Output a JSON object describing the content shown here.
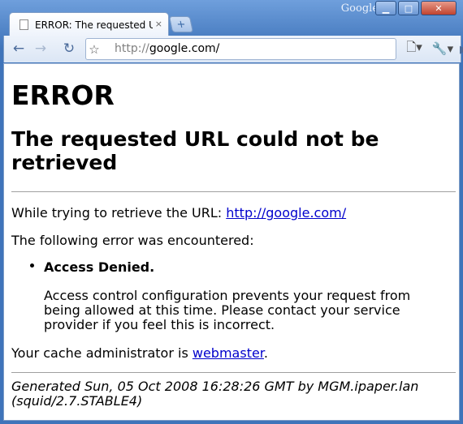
{
  "window": {
    "brand": "Google",
    "controls": {
      "minimize": "▁",
      "maximize": "□",
      "close": "✕"
    }
  },
  "tab": {
    "title": "ERROR: The requested U...",
    "close": "×",
    "new_tab": "+"
  },
  "toolbar": {
    "back": "←",
    "forward": "→",
    "reload": "↻",
    "star": "☆",
    "url_scheme": "http://",
    "url_host": "google.com/",
    "go": "▶",
    "page_menu": "🗋▾",
    "tools_menu": "🔧▾"
  },
  "page": {
    "heading": "ERROR",
    "subheading": "The requested URL could not be retrieved",
    "trying_prefix": "While trying to retrieve the URL: ",
    "trying_url": "http://google.com/",
    "encountered": "The following error was encountered:",
    "error_title": "Access Denied.",
    "error_desc": "Access control configuration prevents your request from being allowed at this time. Please contact your service provider if you feel this is incorrect.",
    "admin_prefix": "Your cache administrator is ",
    "admin_link": "webmaster",
    "admin_suffix": ".",
    "footer": "Generated Sun, 05 Oct 2008 16:28:26 GMT by MGM.ipaper.lan (squid/2.7.STABLE4)"
  }
}
